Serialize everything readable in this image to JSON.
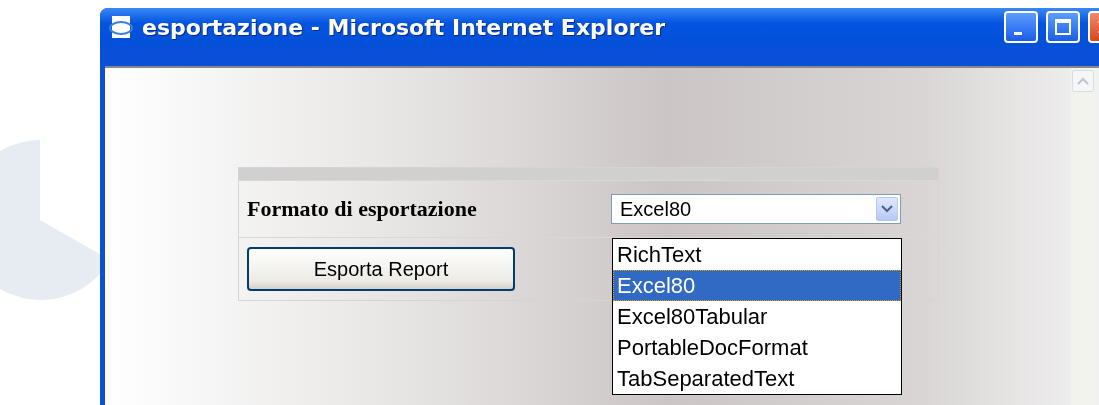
{
  "window": {
    "title": "esportazione - Microsoft Internet Explorer"
  },
  "form": {
    "label": "Formato di esportazione",
    "button": "Esporta Report",
    "select": {
      "value": "Excel80",
      "expanded": true,
      "options": [
        {
          "label": "RichText",
          "selected": false
        },
        {
          "label": "Excel80",
          "selected": true
        },
        {
          "label": "Excel80Tabular",
          "selected": false
        },
        {
          "label": "PortableDocFormat",
          "selected": false
        },
        {
          "label": "TabSeparatedText",
          "selected": false
        }
      ]
    }
  }
}
